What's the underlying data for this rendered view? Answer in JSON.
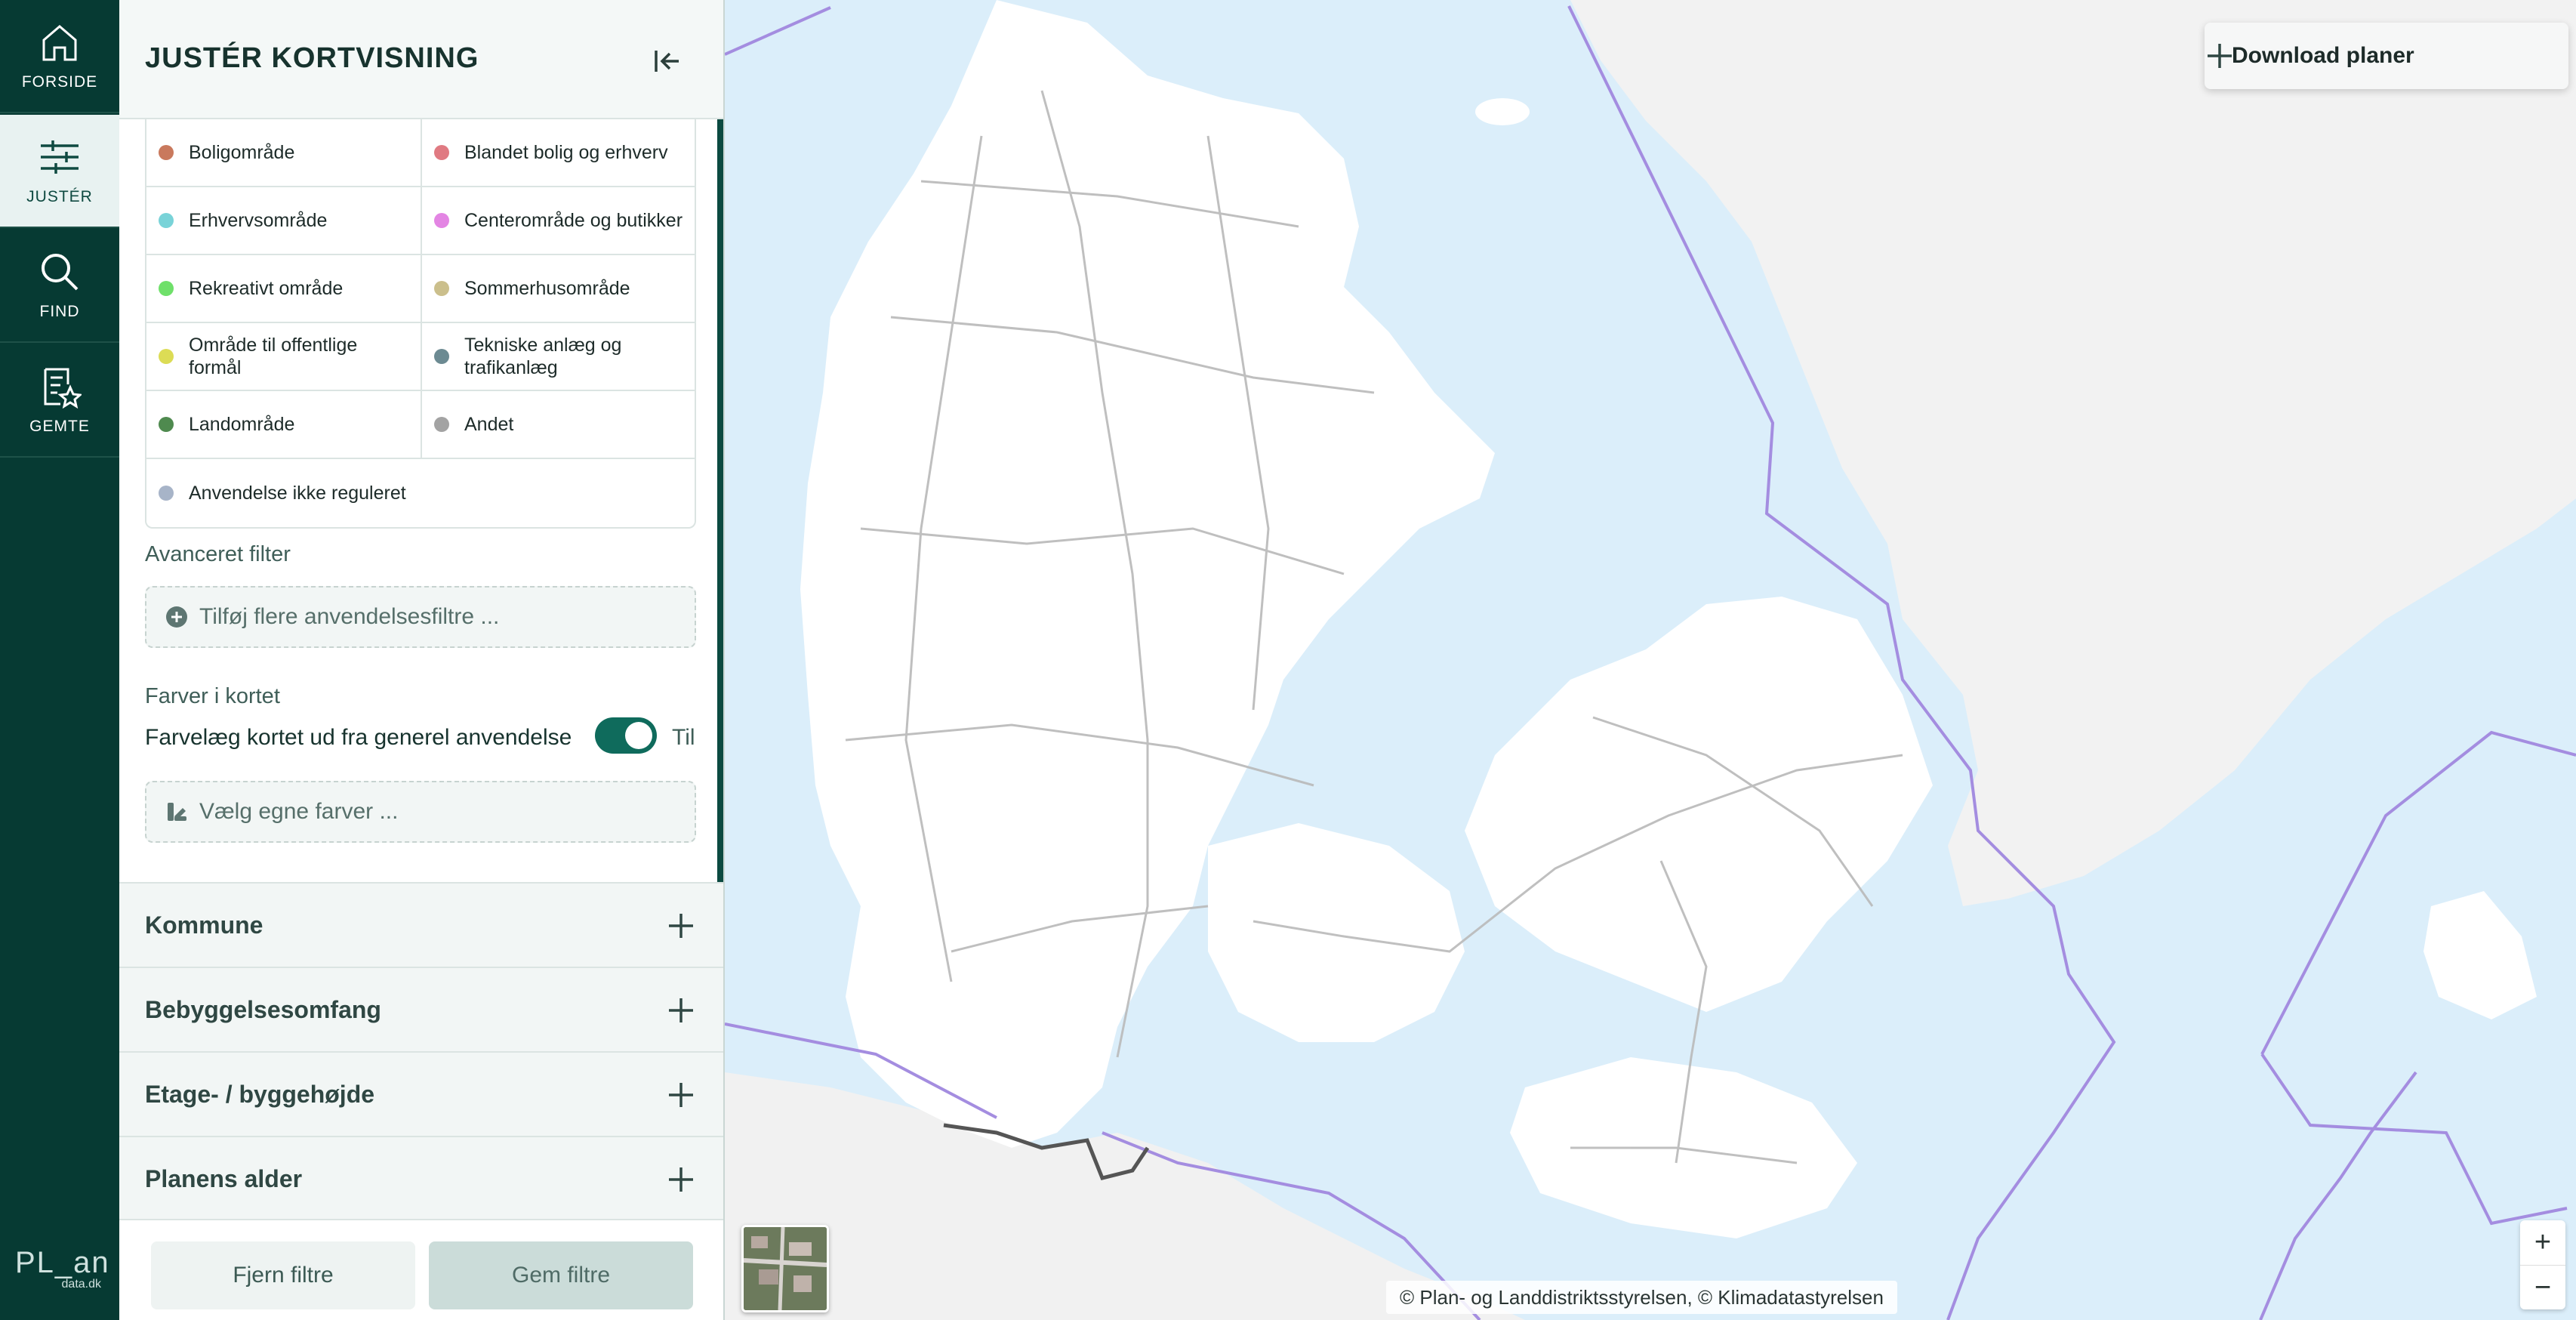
{
  "nav": {
    "items": [
      {
        "label": "FORSIDE",
        "icon": "home-icon"
      },
      {
        "label": "JUSTÉR",
        "icon": "sliders-icon",
        "active": true
      },
      {
        "label": "FIND",
        "icon": "search-icon"
      },
      {
        "label": "GEMTE",
        "icon": "saved-list-icon"
      }
    ],
    "logo": {
      "text": "PL_an",
      "subtext": "data.dk"
    }
  },
  "panel": {
    "title": "JUSTÉR KORTVISNING",
    "collapse_icon": "collapse-left-icon"
  },
  "legend": {
    "rows": [
      [
        {
          "label": "Boligområde",
          "color": "#c9795d"
        },
        {
          "label": "Blandet bolig og erhverv",
          "color": "#e07a82"
        }
      ],
      [
        {
          "label": "Erhvervsområde",
          "color": "#79d3d8"
        },
        {
          "label": "Centerområde og butikker",
          "color": "#e385e3"
        }
      ],
      [
        {
          "label": "Rekreativt område",
          "color": "#6fe06a"
        },
        {
          "label": "Sommerhusområde",
          "color": "#cbbf8c"
        }
      ],
      [
        {
          "label": "Område til offentlige formål",
          "color": "#dcdc55"
        },
        {
          "label": "Tekniske anlæg og trafikanlæg",
          "color": "#6c8a92"
        }
      ],
      [
        {
          "label": "Landområde",
          "color": "#4f8a4f"
        },
        {
          "label": "Andet",
          "color": "#a3a3a3"
        }
      ],
      [
        {
          "label": "Anvendelse ikke reguleret",
          "color": "#a7b4c8"
        }
      ]
    ]
  },
  "advanced_filter": {
    "heading": "Avanceret filter",
    "button": "Tilføj flere anvendelsesfiltre ..."
  },
  "colors": {
    "heading": "Farver i kortet",
    "toggle_label": "Farvelæg kortet ud fra generel anvendelse",
    "toggle_state": "Til",
    "toggle_on": true,
    "custom_button": "Vælg egne farver ..."
  },
  "accordions": [
    {
      "label": "Kommune"
    },
    {
      "label": "Bebyggelsesomfang"
    },
    {
      "label": "Etage- / byggehøjde"
    },
    {
      "label": "Planens alder"
    }
  ],
  "footer": {
    "remove": "Fjern filtre",
    "save": "Gem filtre"
  },
  "map": {
    "download_label": "Download planer",
    "attribution": "© Plan- og Landdistriktsstyrelsen, © Klimadatastyrelsen",
    "zoom_in": "+",
    "zoom_out": "−",
    "water_color": "#dbeefa",
    "land_color": "#ffffff"
  },
  "accent_color": "#063a33"
}
